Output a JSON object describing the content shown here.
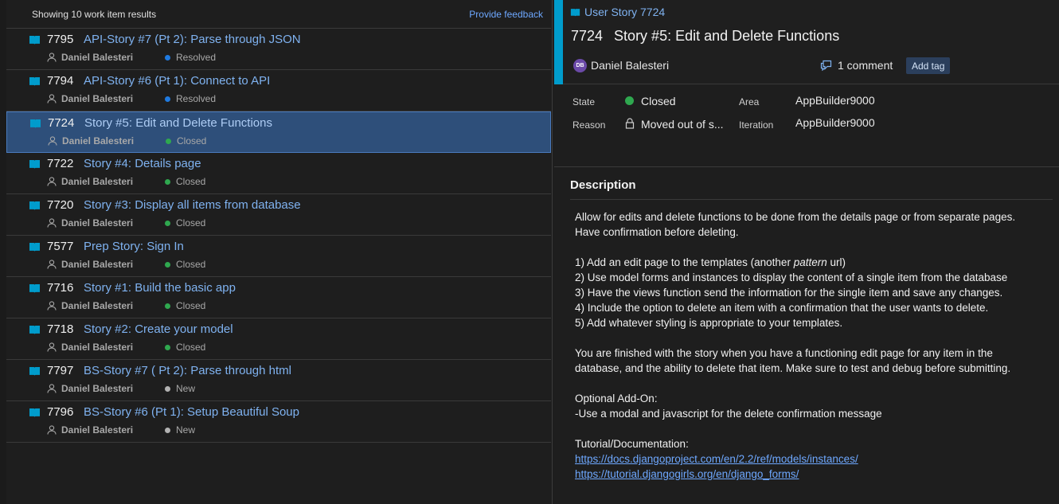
{
  "results": {
    "count_label": "Showing 10 work item results",
    "feedback_label": "Provide feedback"
  },
  "items": [
    {
      "id": "7795",
      "title": "API-Story #7 (Pt 2): Parse through JSON",
      "assignee": "Daniel Balesteri",
      "state": "Resolved",
      "state_color": "#1f7ae0"
    },
    {
      "id": "7794",
      "title": "API-Story #6 (Pt 1): Connect to API",
      "assignee": "Daniel Balesteri",
      "state": "Resolved",
      "state_color": "#1f7ae0"
    },
    {
      "id": "7724",
      "title": "Story #5: Edit and Delete Functions",
      "assignee": "Daniel Balesteri",
      "state": "Closed",
      "state_color": "#2fa84f",
      "selected": true
    },
    {
      "id": "7722",
      "title": "Story #4: Details page",
      "assignee": "Daniel Balesteri",
      "state": "Closed",
      "state_color": "#2fa84f"
    },
    {
      "id": "7720",
      "title": "Story #3: Display all items from database",
      "assignee": "Daniel Balesteri",
      "state": "Closed",
      "state_color": "#2fa84f"
    },
    {
      "id": "7577",
      "title": "Prep Story: Sign In",
      "assignee": "Daniel Balesteri",
      "state": "Closed",
      "state_color": "#2fa84f"
    },
    {
      "id": "7716",
      "title": "Story #1: Build the basic app",
      "assignee": "Daniel Balesteri",
      "state": "Closed",
      "state_color": "#2fa84f"
    },
    {
      "id": "7718",
      "title": "Story #2: Create your model",
      "assignee": "Daniel Balesteri",
      "state": "Closed",
      "state_color": "#2fa84f"
    },
    {
      "id": "7797",
      "title": "BS-Story #7 ( Pt 2): Parse through html",
      "assignee": "Daniel Balesteri",
      "state": "New",
      "state_color": "#b2b2b2"
    },
    {
      "id": "7796",
      "title": "BS-Story #6 (Pt 1): Setup Beautiful Soup",
      "assignee": "Daniel Balesteri",
      "state": "New",
      "state_color": "#b2b2b2"
    }
  ],
  "detail": {
    "type_label": "User Story 7724",
    "id": "7724",
    "title": "Story #5: Edit and Delete Functions",
    "avatar_initials": "DB",
    "owner": "Daniel Balesteri",
    "comments_label": "1 comment",
    "add_tag_label": "Add tag",
    "accent_color": "#009ccc",
    "fields": {
      "state_label": "State",
      "state_value": "Closed",
      "reason_label": "Reason",
      "reason_value": "Moved out of s...",
      "area_label": "Area",
      "area_value": "AppBuilder9000",
      "iteration_label": "Iteration",
      "iteration_value": "AppBuilder9000"
    },
    "description": {
      "heading": "Description",
      "intro_1": "Allow for edits and delete functions to be done from the details page or from separate pages.",
      "intro_2": "Have confirmation before deleting.",
      "step_1_pre": "1) Add an edit page to the templates (another ",
      "step_1_em": "pattern",
      "step_1_post": " url)",
      "step_2": "2) Use model forms and instances to display the content of a single item from the database",
      "step_3": "3) Have the views function send the information for the single item and save any changes.",
      "step_4": "4) Include the option to delete an item with a confirmation that the user wants to delete.",
      "step_5": "5) Add whatever styling is appropriate to your templates.",
      "finish_1": "You are finished with the story when you have a functioning edit page for any item in the",
      "finish_2": "database, and the ability to delete that item. Make sure to test and debug before submitting.",
      "addon_heading": "Optional Add-On:",
      "addon_text": "-Use a modal and javascript for the delete confirmation message",
      "tutorial_heading": "Tutorial/Documentation:",
      "link_1": "https://docs.djangoproject.com/en/2.2/ref/models/instances/",
      "link_2": "https://tutorial.djangogirls.org/en/django_forms/"
    }
  }
}
